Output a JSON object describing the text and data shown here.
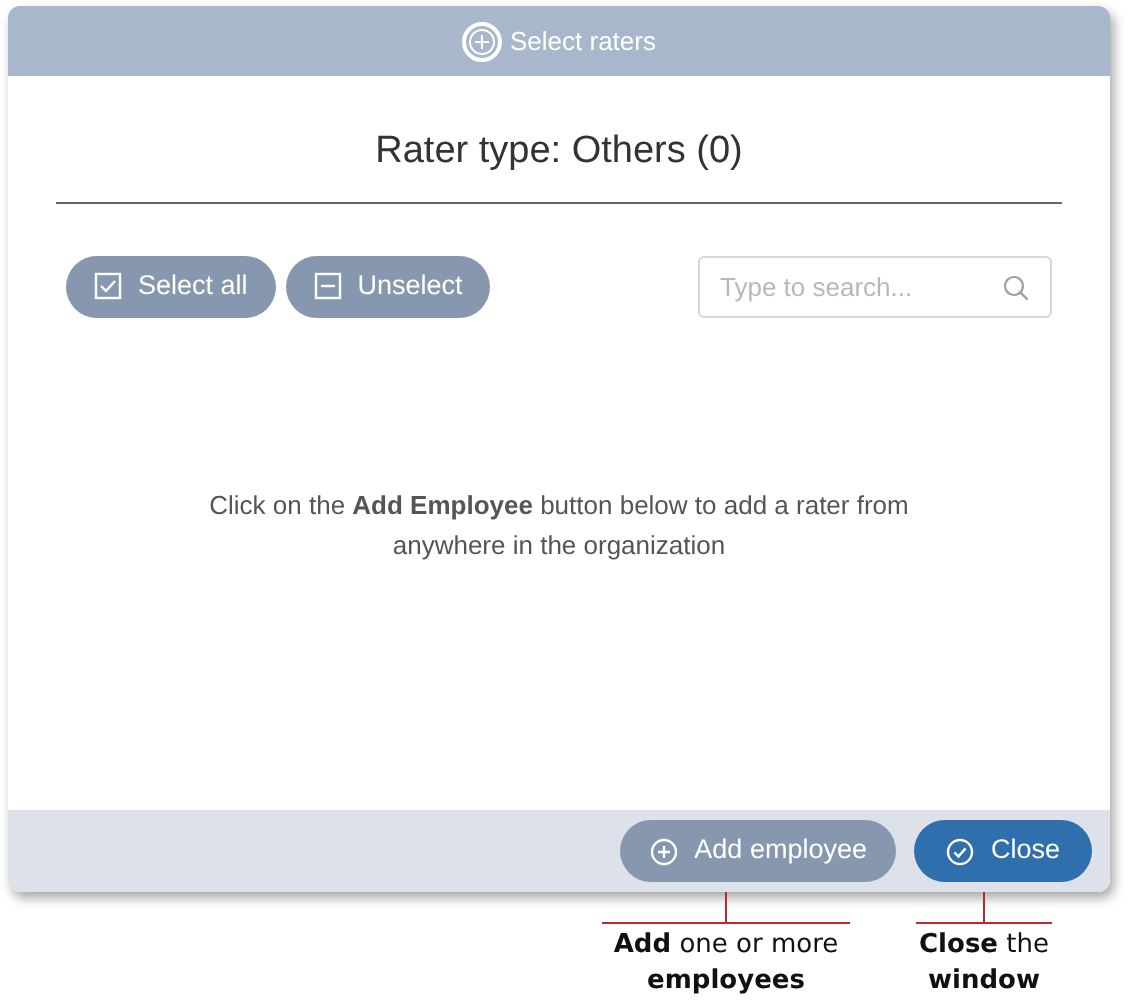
{
  "dialog": {
    "title": "Select raters",
    "heading": "Rater type: Others (0)",
    "toolbar_buttons": [
      {
        "label": "Select all",
        "kind": "check"
      },
      {
        "label": "Unselect",
        "kind": "minus"
      }
    ],
    "search": {
      "placeholder": "Type to search..."
    },
    "message": "Click on the **Add Employee** button below to add a rater from anywhere in the organization",
    "footer_buttons": [
      {
        "label": "Add employee",
        "kind": "add",
        "primary": false
      },
      {
        "label": "Close",
        "kind": "close",
        "primary": true
      }
    ]
  },
  "annotations": [
    {
      "text": "**Add** one or more **employees**"
    },
    {
      "text": "**Close** the **window**"
    }
  ]
}
